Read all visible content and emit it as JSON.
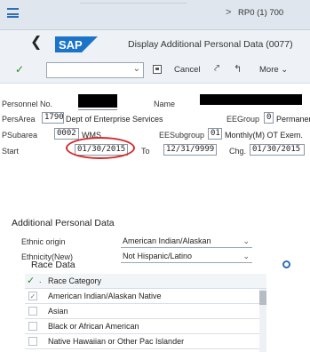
{
  "system": {
    "breadcrumb_arrow": ">",
    "info": "RP0 (1) 700"
  },
  "header": {
    "title": "Display Additional Personal Data (0077)"
  },
  "toolbar": {
    "cancel_label": "Cancel",
    "more_label": "More"
  },
  "personnel": {
    "personnel_no_label": "Personnel No.",
    "name_label": "Name",
    "persarea_label": "PersArea",
    "persarea_code": "1790",
    "persarea_text": "Dept of Enterprise Services",
    "eegroup_label": "EEGroup",
    "eegroup_code": "0",
    "eegroup_text": "Permaner",
    "psubarea_label": "PSubarea",
    "psubarea_code": "0002",
    "psubarea_text": "WMS",
    "eesubgroup_label": "EESubgroup",
    "eesubgroup_code": "01",
    "eesubgroup_text": "Monthly(M) OT Exem.",
    "start_label": "Start",
    "start_value": "01/30/2015",
    "to_label": "To",
    "to_value": "12/31/9999",
    "chg_label": "Chg.",
    "chg_value": "01/30/2015"
  },
  "additional": {
    "section_title": "Additional Personal Data",
    "ethnic_origin_label": "Ethnic origin",
    "ethnic_origin_value": "American Indian/Alaskan",
    "ethnicity_label": "Ethnicity(New)",
    "ethnicity_value": "Not Hispanic/Latino"
  },
  "race": {
    "title": "Race Data",
    "column_header": "Race Category",
    "header_dot": ".",
    "rows": [
      {
        "label": "American Indian/Alaskan Native",
        "checked": true
      },
      {
        "label": "Asian",
        "checked": false
      },
      {
        "label": "Black or African American",
        "checked": false
      },
      {
        "label": "Native Hawaiian or Other Pac Islander",
        "checked": false
      }
    ]
  },
  "icons": {
    "menu": "hamburger-icon",
    "back": "chevron-left-icon",
    "enter": "checkmark-icon",
    "save": "save-icon",
    "settings": "settings-icon"
  },
  "colors": {
    "accent": "#2f6eb5",
    "highlight_circle": "#d32b2b",
    "confirm": "#2a8a2a"
  }
}
